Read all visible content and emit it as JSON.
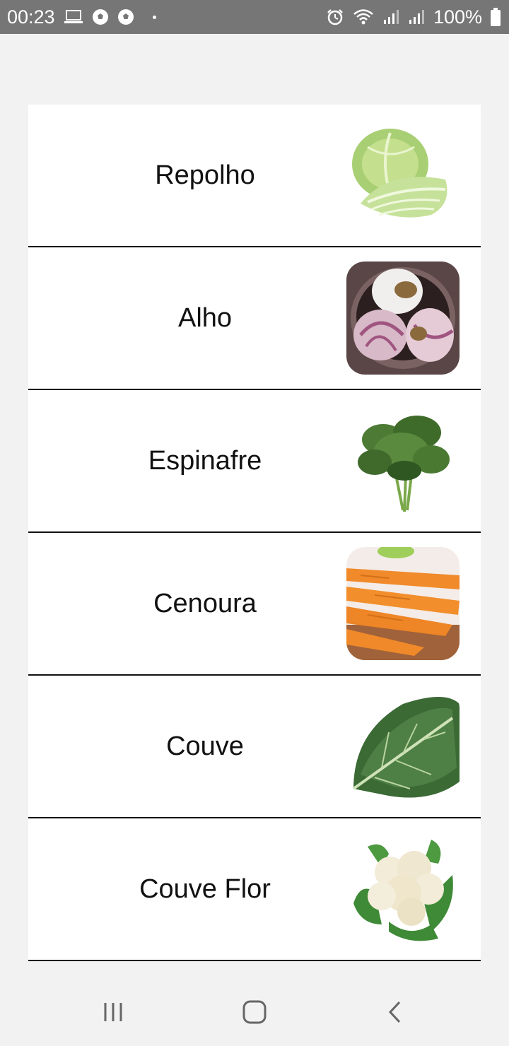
{
  "status_bar": {
    "time": "00:23",
    "battery": "100%",
    "icons": [
      "laptop-icon",
      "soccer-ball-icon",
      "soccer-ball-icon",
      "alarm-icon",
      "wifi-icon",
      "signal-icon",
      "signal-icon",
      "battery-icon"
    ]
  },
  "vegetables": [
    {
      "label": "Repolho",
      "image": "cabbage"
    },
    {
      "label": "Alho",
      "image": "garlic"
    },
    {
      "label": "Espinafre",
      "image": "spinach"
    },
    {
      "label": "Cenoura",
      "image": "carrots"
    },
    {
      "label": "Couve",
      "image": "collard-greens"
    },
    {
      "label": "Couve Flor",
      "image": "cauliflower"
    }
  ],
  "navigation": {
    "icons": [
      "recent-apps-icon",
      "home-icon",
      "back-icon"
    ]
  }
}
